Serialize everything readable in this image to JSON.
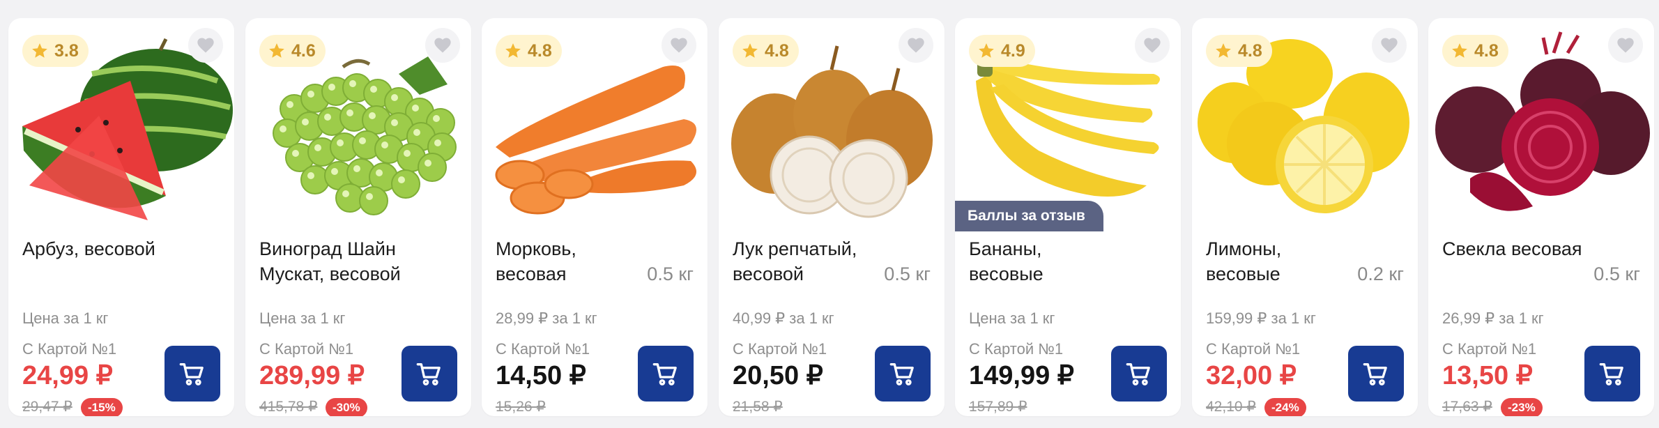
{
  "products": [
    {
      "rating": "3.8",
      "name": "Арбуз, весовой",
      "weight": "",
      "unit_price": "Цена за 1 кг",
      "card_label": "С Картой №1",
      "price": "24,99 ₽",
      "old_price": "29,47 ₽",
      "discount": "-15%",
      "promo": "",
      "icon": "watermelon"
    },
    {
      "rating": "4.6",
      "name": "Виноград Шайн Мускат, весовой",
      "weight": "",
      "unit_price": "Цена за 1 кг",
      "card_label": "С Картой №1",
      "price": "289,99 ₽",
      "old_price": "415,78 ₽",
      "discount": "-30%",
      "promo": "",
      "icon": "grapes"
    },
    {
      "rating": "4.8",
      "name": "Морковь, весовая",
      "weight": "0.5 кг",
      "unit_price": "28,99 ₽ за 1 кг",
      "card_label": "С Картой №1",
      "price": "14,50 ₽",
      "old_price": "15,26 ₽",
      "discount": "",
      "promo": "",
      "icon": "carrot"
    },
    {
      "rating": "4.8",
      "name": "Лук репчатый, весовой",
      "weight": "0.5 кг",
      "unit_price": "40,99 ₽ за 1 кг",
      "card_label": "С Картой №1",
      "price": "20,50 ₽",
      "old_price": "21,58 ₽",
      "discount": "",
      "promo": "",
      "icon": "onion"
    },
    {
      "rating": "4.9",
      "name": "Бананы, весовые",
      "weight": "",
      "unit_price": "Цена за 1 кг",
      "card_label": "С Картой №1",
      "price": "149,99 ₽",
      "old_price": "157,89 ₽",
      "discount": "",
      "promo": "Баллы за отзыв",
      "icon": "banana"
    },
    {
      "rating": "4.8",
      "name": "Лимоны, весовые",
      "weight": "0.2 кг",
      "unit_price": "159,99 ₽ за 1 кг",
      "card_label": "С Картой №1",
      "price": "32,00 ₽",
      "old_price": "42,10 ₽",
      "discount": "-24%",
      "promo": "",
      "icon": "lemon"
    },
    {
      "rating": "4.8",
      "name": "Свекла весовая",
      "weight": "0.5 кг",
      "unit_price": "26,99 ₽ за 1 кг",
      "card_label": "С Картой №1",
      "price": "13,50 ₽",
      "old_price": "17,63 ₽",
      "discount": "-23%",
      "promo": "",
      "icon": "beet"
    }
  ],
  "colors": {
    "sale_price": "#e84545",
    "regular_price": "#141414",
    "cart_button": "#183b93",
    "rating_bg": "#fff4cf",
    "star": "#f2b833",
    "promo_bg": "#5b6383"
  }
}
